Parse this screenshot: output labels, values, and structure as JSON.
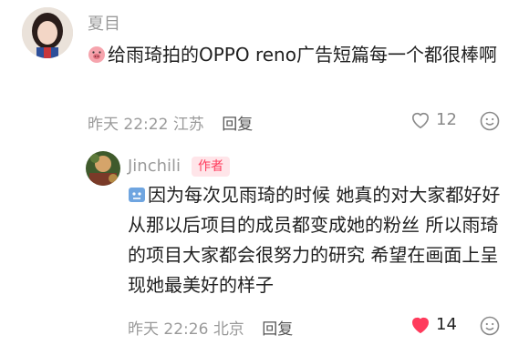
{
  "comments": [
    {
      "username": "夏目",
      "text": "给雨琦拍的OPPO reno广告短篇每一个都很棒啊",
      "time": "昨天 22:22",
      "location": "江苏",
      "reply_label": "回复",
      "likes": "12",
      "liked": false
    },
    {
      "username": "Jinchili",
      "badge": "作者",
      "text": "因为每次见雨琦的时候 她真的对大家都好好 从那以后项目的成员都变成她的粉丝 所以雨琦的项目大家都会很努力的研究 希望在画面上呈现她最美好的样子",
      "time": "昨天 22:26",
      "location": "北京",
      "reply_label": "回复",
      "likes": "14",
      "liked": true
    }
  ],
  "colors": {
    "like_active": "#ff3b5c",
    "badge_bg": "#ffe5e9",
    "badge_text": "#ff3b5c",
    "muted": "#9a9a9a"
  },
  "icons": {
    "inline_emoji_1": "pig-face-emoji",
    "inline_emoji_2": "puzzled-emoji",
    "like": "heart-icon",
    "react": "smiley-icon"
  }
}
